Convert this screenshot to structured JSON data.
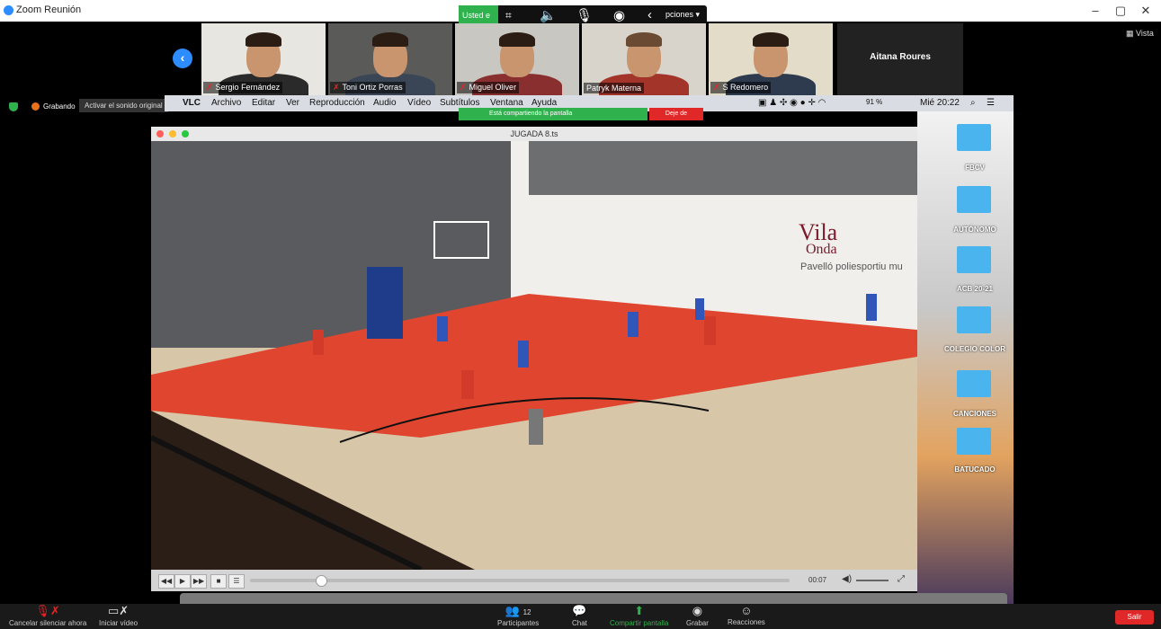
{
  "zoom": {
    "window_title": "Zoom Reunión",
    "share_toolbar": {
      "you_label": "Usted e",
      "options_label": "pciones ▾"
    },
    "vista_label": "Vista",
    "recording_label": "Grabando",
    "activate_sound_label": "Activar el sonido original",
    "participants": [
      {
        "name": "Sergio Fernández"
      },
      {
        "name": "Toni Ortiz Porras"
      },
      {
        "name": "Miguel Oliver"
      },
      {
        "name": "Patryk Materna"
      },
      {
        "name": "S Redomero"
      }
    ],
    "active_speaker_name": "Aitana Roures",
    "bottom_bar": {
      "mute_label": "Cancelar silenciar ahora",
      "video_label": "Iniciar vídeo",
      "participants_label": "Participantes",
      "participants_count": "12",
      "chat_label": "Chat",
      "share_label": "Compartir pantalla",
      "record_label": "Grabar",
      "reactions_label": "Reacciones",
      "leave_label": "Salir"
    }
  },
  "mac_menubar": {
    "items": [
      "VLC",
      "Archivo",
      "Editar",
      "Ver",
      "Reproducción",
      "Audio",
      "Vídeo",
      "Subtítulos",
      "Ventana",
      "Ayuda"
    ],
    "battery": "91 %",
    "clock": "Mié 20:22"
  },
  "sharing_banner": {
    "text": "Está compartiendo la pantalla",
    "stop_label": "Deje de"
  },
  "vlc": {
    "window_title": "JUGADA 8.ts",
    "time": "00:07",
    "progress_fraction": 0.2
  },
  "desktop_folders": [
    "FBCV",
    "AUTÓNOMO",
    "ACB 20-21",
    "COLEGIO COLOR",
    "CANCIONES",
    "BATUCADO"
  ],
  "video_scene": {
    "banner_line1": "Vila",
    "banner_line2": "Onda",
    "banner_line3": "Pavelló poliesportiu mu"
  }
}
